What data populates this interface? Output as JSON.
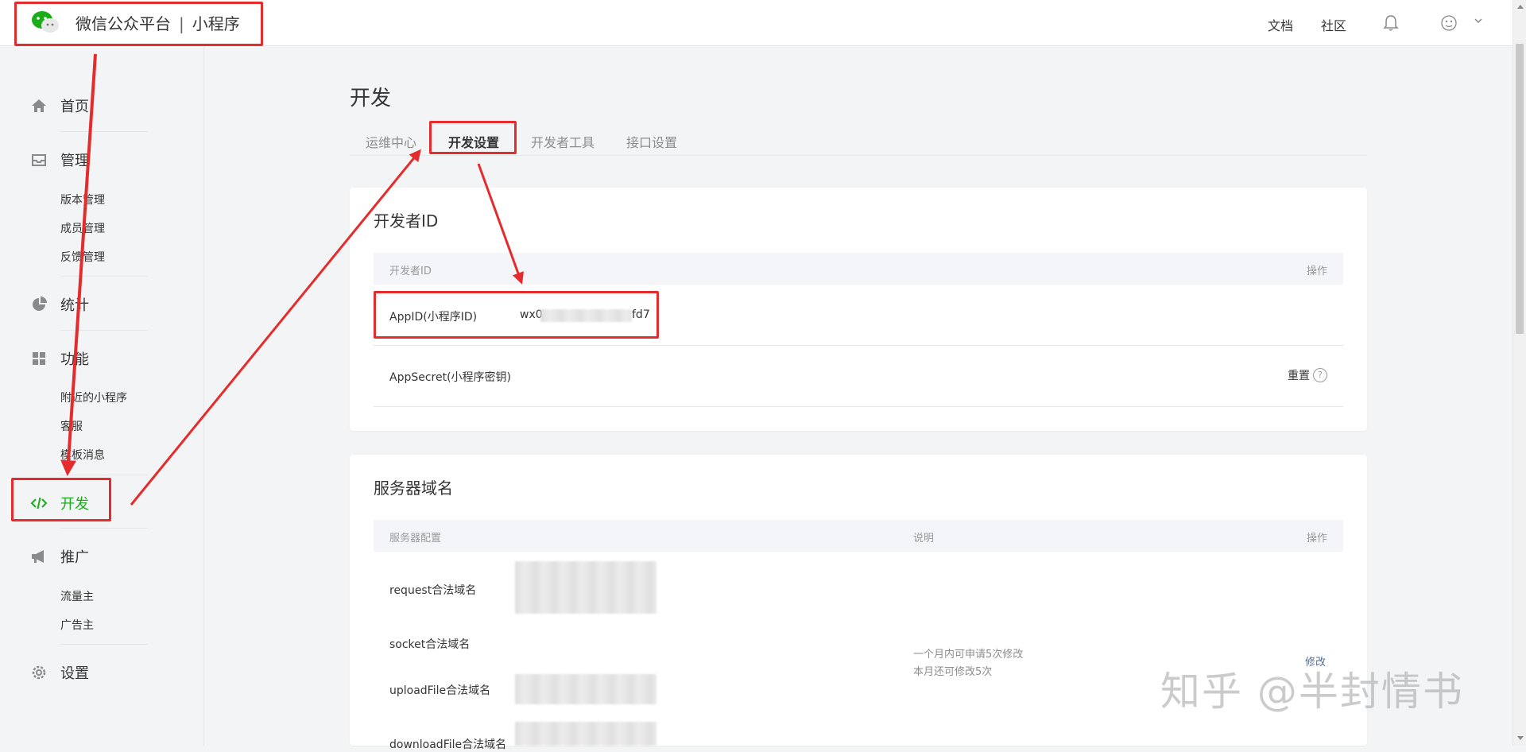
{
  "header": {
    "brand_main": "微信公众平台",
    "brand_sep": "|",
    "brand_sub": "小程序",
    "links": [
      "文档",
      "社区"
    ]
  },
  "sidebar": {
    "home": "首页",
    "manage": {
      "label": "管理",
      "items": [
        "版本管理",
        "成员管理",
        "反馈管理"
      ]
    },
    "stats": "统计",
    "features": {
      "label": "功能",
      "items": [
        "附近的小程序",
        "客服",
        "模板消息"
      ]
    },
    "dev": "开发",
    "promo": {
      "label": "推广",
      "items": [
        "流量主",
        "广告主"
      ]
    },
    "settings": "设置"
  },
  "main": {
    "title": "开发",
    "tabs": [
      "运维中心",
      "开发设置",
      "开发者工具",
      "接口设置"
    ],
    "dev_id_card": {
      "title": "开发者ID",
      "col_id": "开发者ID",
      "col_op": "操作",
      "appid_label": "AppID(小程序ID)",
      "appid_prefix": "wx0",
      "appid_suffix": "fd7",
      "secret_label": "AppSecret(小程序密钥)",
      "reset_label": "重置",
      "help_glyph": "?"
    },
    "server_card": {
      "title": "服务器域名",
      "col_config": "服务器配置",
      "col_desc": "说明",
      "col_op": "操作",
      "rows": [
        "request合法域名",
        "socket合法域名",
        "uploadFile合法域名",
        "downloadFile合法域名"
      ],
      "desc_line1": "一个月内可申请5次修改",
      "desc_line2": "本月还可修改5次",
      "modify_label": "修改"
    }
  },
  "watermark": "知乎 @半封情书",
  "colors": {
    "accent_green": "#1aad19",
    "annotation_red": "#e42c2c"
  }
}
